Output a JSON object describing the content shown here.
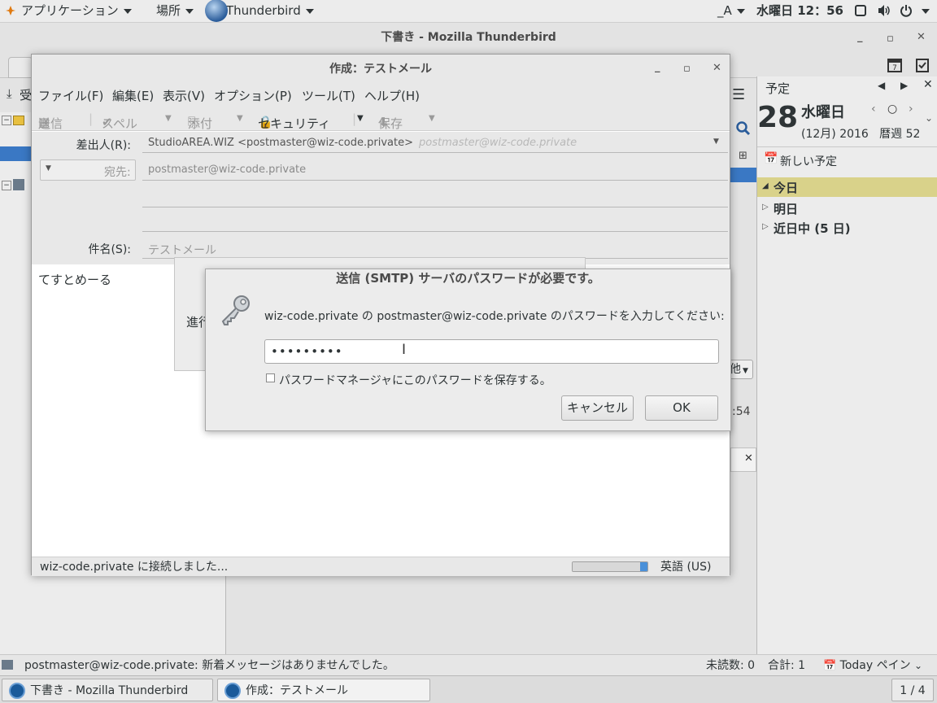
{
  "topbar": {
    "applications": "アプリケーション",
    "places": "場所",
    "app_name": "Thunderbird",
    "input_method": "_A",
    "clock": "水曜日 12：56"
  },
  "main_window": {
    "title": "下書き  -  Mozilla Thunderbird",
    "receive_label": "受",
    "status_text": "postmaster@wiz-code.private: 新着メッセージはありませんでした。",
    "unread": "未読数: 0",
    "total": "合計: 1",
    "today_pane": "Today ペイン",
    "other_button": "他",
    "time_fragment": ":54"
  },
  "today_pane": {
    "header": "予定",
    "day_number": "28",
    "weekday": "水曜日",
    "month_year_week": "(12月) 2016   暦週 52",
    "new_event": "新しい予定",
    "sections": [
      "今日",
      "明日",
      "近日中 (5 日)"
    ]
  },
  "compose": {
    "title": "作成：テストメール",
    "menu": [
      "ファイル(F)",
      "編集(E)",
      "表示(V)",
      "オプション(P)",
      "ツール(T)",
      "ヘルプ(H)"
    ],
    "toolbar": {
      "send": "送信",
      "spell": "スペル",
      "attach": "添付",
      "security": "セキュリティ",
      "save": "保存"
    },
    "from_label": "差出人(R):",
    "from_value": "StudioAREA.WIZ <postmaster@wiz-code.private>",
    "from_hint": "postmaster@wiz-code.private",
    "to_label": "宛先:",
    "to_value": "postmaster@wiz-code.private",
    "subject_label": "件名(S):",
    "subject_value": "テストメール",
    "body": "てすとめーる",
    "status": "wiz-code.private に接続しました...",
    "language": "英語 (US)",
    "progress": 0.95
  },
  "progress_dialog": {
    "progress_label": "進行"
  },
  "password_dialog": {
    "title": "送信 (SMTP) サーバのパスワードが必要です。",
    "prompt": "wiz-code.private の postmaster@wiz-code.private のパスワードを入力してください:",
    "masked_value": "•••••••••",
    "save_checkbox": "パスワードマネージャにこのパスワードを保存する。",
    "cancel": "キャンセル",
    "ok": "OK"
  },
  "taskbar": {
    "items": [
      "下書き  -  Mozilla Thunderbird",
      "作成：テストメール"
    ],
    "workspace": "1 / 4"
  }
}
